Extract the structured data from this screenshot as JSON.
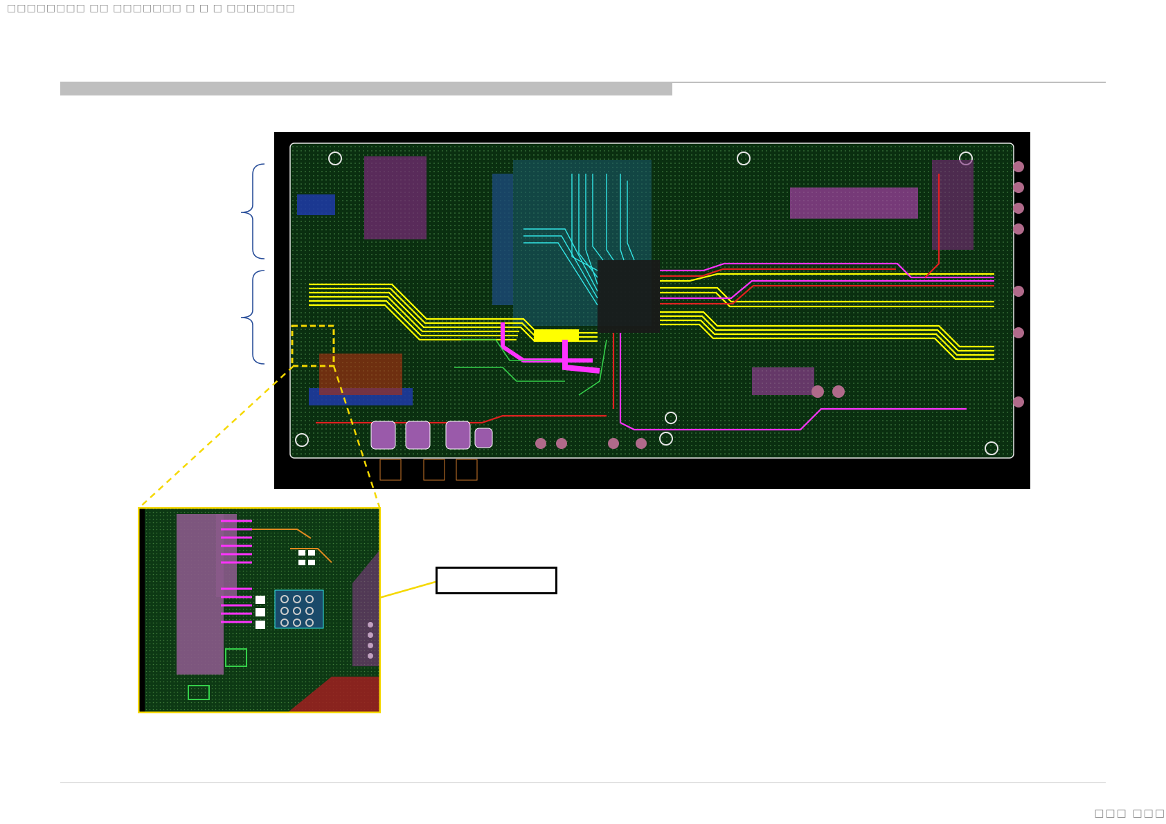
{
  "header": {
    "text": "□□□□□□□□ □□ □□□□□□□ □ □ □ □□□□□□□"
  },
  "footer": {
    "page_text": "□□□ □□□"
  },
  "callout": {
    "label": ""
  },
  "colors": {
    "board_bg": "#0a2f10",
    "trace_yellow": "#ffff00",
    "trace_magenta": "#ff33ff",
    "trace_red": "#e02020",
    "trace_cyan": "#33e6e6",
    "highlight_box": "#f5d800",
    "brace": "#2a4f9a"
  }
}
